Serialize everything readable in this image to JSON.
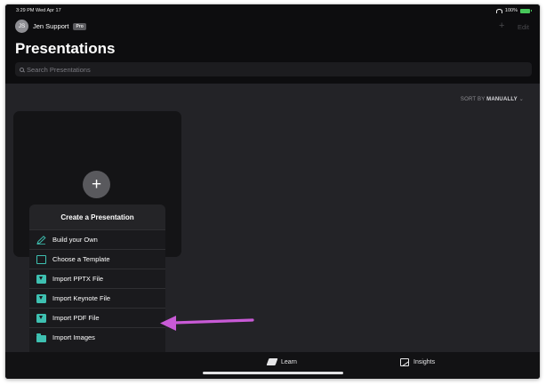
{
  "status_bar": {
    "time_date": "3:29 PM  Wed Apr 17",
    "battery": "100%"
  },
  "header": {
    "avatar_initials": "JS",
    "user_name": "Jen Support",
    "badge": "Pro",
    "add_label": "+",
    "edit_label": "Edit",
    "title": "Presentations"
  },
  "search": {
    "placeholder": "Search Presentations"
  },
  "sort": {
    "prefix": "SORT BY",
    "value": "MANUALLY"
  },
  "card": {
    "add_label": "+"
  },
  "popover": {
    "title": "Create a Presentation",
    "items": [
      {
        "label": "Build your Own",
        "icon": "pencil-icon"
      },
      {
        "label": "Choose a Template",
        "icon": "template-icon"
      },
      {
        "label": "Import PPTX File",
        "icon": "import-icon"
      },
      {
        "label": "Import Keynote File",
        "icon": "import-icon"
      },
      {
        "label": "Import PDF File",
        "icon": "import-icon"
      },
      {
        "label": "Import Images",
        "icon": "folder-icon"
      }
    ]
  },
  "tabbar": {
    "tabs": [
      {
        "label": "Learn",
        "icon": "learn-icon"
      },
      {
        "label": "Insights",
        "icon": "insights-icon"
      }
    ]
  },
  "colors": {
    "accent": "#3ec0b1",
    "annotation_arrow": "#c85ad6"
  }
}
